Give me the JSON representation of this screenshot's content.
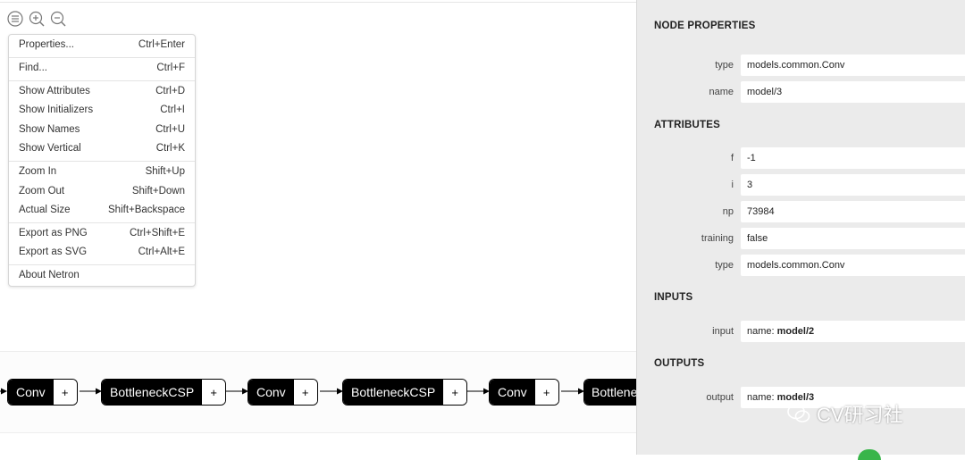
{
  "toolbar": {
    "icons": [
      "menu-icon",
      "zoom-in-icon",
      "zoom-out-icon"
    ]
  },
  "menu": {
    "items": [
      {
        "label": "Properties...",
        "shortcut": "Ctrl+Enter"
      },
      {
        "label": "Find...",
        "shortcut": "Ctrl+F"
      },
      {
        "label": "Show Attributes",
        "shortcut": "Ctrl+D"
      },
      {
        "label": "Show Initializers",
        "shortcut": "Ctrl+I"
      },
      {
        "label": "Show Names",
        "shortcut": "Ctrl+U"
      },
      {
        "label": "Show Vertical",
        "shortcut": "Ctrl+K"
      },
      {
        "label": "Zoom In",
        "shortcut": "Shift+Up"
      },
      {
        "label": "Zoom Out",
        "shortcut": "Shift+Down"
      },
      {
        "label": "Actual Size",
        "shortcut": "Shift+Backspace"
      },
      {
        "label": "Export as PNG",
        "shortcut": "Ctrl+Shift+E"
      },
      {
        "label": "Export as SVG",
        "shortcut": "Ctrl+Alt+E"
      },
      {
        "label": "About Netron",
        "shortcut": ""
      }
    ]
  },
  "graph": {
    "nodes": [
      {
        "name": "Conv",
        "plus": "+"
      },
      {
        "name": "BottleneckCSP",
        "plus": "+"
      },
      {
        "name": "Conv",
        "plus": "+"
      },
      {
        "name": "BottleneckCSP",
        "plus": "+"
      },
      {
        "name": "Conv",
        "plus": "+"
      },
      {
        "name": "Bottlene",
        "plus": ""
      }
    ]
  },
  "panel": {
    "node_properties_title": "NODE PROPERTIES",
    "node": [
      {
        "label": "type",
        "value": "models.common.Conv"
      },
      {
        "label": "name",
        "value": "model/3"
      }
    ],
    "attributes_title": "ATTRIBUTES",
    "attributes": [
      {
        "label": "f",
        "value": "-1"
      },
      {
        "label": "i",
        "value": "3"
      },
      {
        "label": "np",
        "value": "73984"
      },
      {
        "label": "training",
        "value": "false"
      },
      {
        "label": "type",
        "value": "models.common.Conv"
      }
    ],
    "inputs_title": "INPUTS",
    "inputs": [
      {
        "label": "input",
        "prefix": "name:",
        "value": "model/2"
      }
    ],
    "outputs_title": "OUTPUTS",
    "outputs": [
      {
        "label": "output",
        "prefix": "name:",
        "value": "model/3"
      }
    ]
  },
  "watermark": {
    "text": "CV研习社"
  },
  "colors": {
    "node": "#000000",
    "panel_bg": "#ebebeb",
    "accent_green": "#39b54a"
  }
}
